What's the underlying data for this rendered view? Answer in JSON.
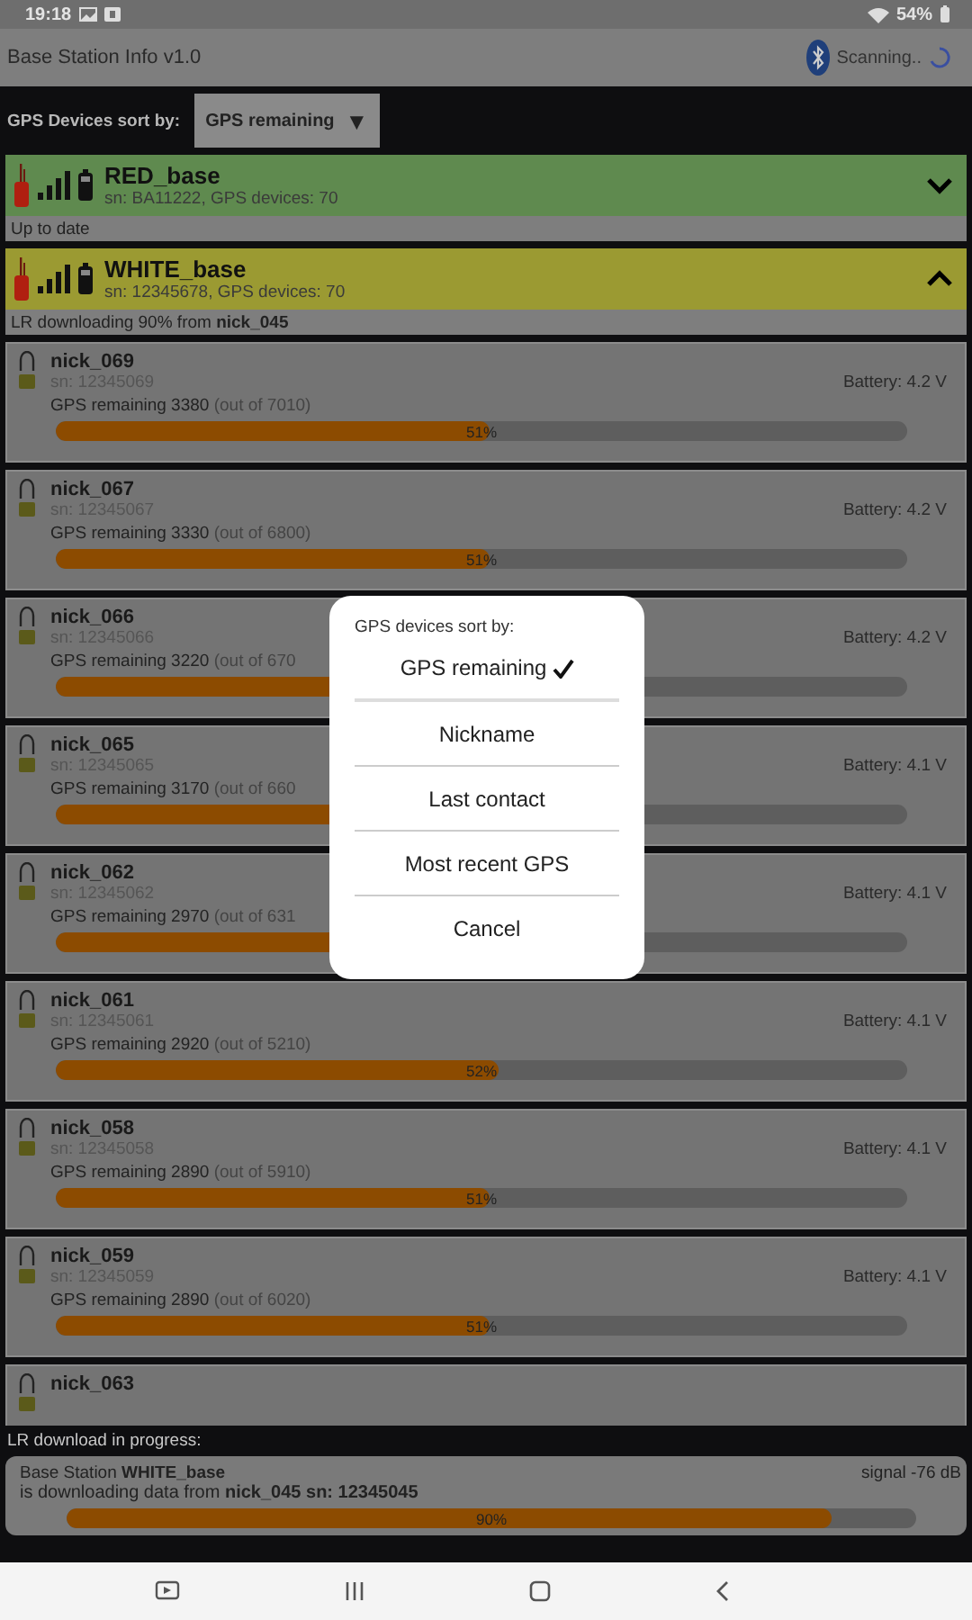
{
  "status_bar": {
    "time": "19:18",
    "battery": "54%"
  },
  "app_bar": {
    "title": "Base Station Info v1.0",
    "scan_status": "Scanning.."
  },
  "sort_bar": {
    "label": "GPS Devices sort by:",
    "value": "GPS remaining",
    "arrow": "▼"
  },
  "base_stations": [
    {
      "name": "RED_base",
      "details": "sn: BA11222, GPS devices: 70",
      "color": "#5f8a4f",
      "expanded": false,
      "status": "Up to date"
    },
    {
      "name": "WHITE_base",
      "details": "sn: 12345678, GPS devices: 70",
      "color": "#9b9a32",
      "expanded": true,
      "status": "LR downloading 90% from **nick_045**"
    }
  ],
  "devices": [
    {
      "name": "nick_069",
      "sn": "sn: 12345069",
      "battery": "Battery: 4.2 V",
      "remaining": "GPS remaining 3380",
      "total": "(out of 7010)",
      "level": 0.51,
      "percent": "51%"
    },
    {
      "name": "nick_067",
      "sn": "sn: 12345067",
      "battery": "Battery: 4.2 V",
      "remaining": "GPS remaining 3330",
      "total": "(out of 6800)",
      "level": 0.51,
      "percent": "51%"
    },
    {
      "name": "nick_066",
      "sn": "sn: 12345066",
      "battery": "Battery: 4.2 V",
      "remaining": "GPS remaining 3220",
      "total": "(out of 670",
      "level": 0.51
    },
    {
      "name": "nick_065",
      "sn": "sn: 12345065",
      "battery": "Battery: 4.1 V",
      "remaining": "GPS remaining 3170",
      "total": "(out of 660",
      "level": 0.51
    },
    {
      "name": "nick_062",
      "sn": "sn: 12345062",
      "battery": "Battery: 4.1 V",
      "remaining": "GPS remaining 2970",
      "total": "(out of 631",
      "level": 0.51
    },
    {
      "name": "nick_061",
      "sn": "sn: 12345061",
      "battery": "Battery: 4.1 V",
      "remaining": "GPS remaining 2920",
      "total": "(out of 5210)",
      "level": 0.52,
      "percent": "52%"
    },
    {
      "name": "nick_058",
      "sn": "sn: 12345058",
      "battery": "Battery: 4.1 V",
      "remaining": "GPS remaining 2890",
      "total": "(out of 5910)",
      "level": 0.51,
      "percent": "51%"
    },
    {
      "name": "nick_059",
      "sn": "sn: 12345059",
      "battery": "Battery: 4.1 V",
      "remaining": "GPS remaining 2890",
      "total": "(out of 6020)",
      "level": 0.51,
      "percent": "51%"
    },
    {
      "name": "nick_063"
    }
  ],
  "download_panel": {
    "heading": "LR download in progress:",
    "station": "Base Station **WHITE_base**",
    "signal": "signal -76 dB",
    "source": "is downloading data from **nick_045 sn: 12345045**",
    "level": 0.9,
    "percent": "90%"
  },
  "dialog": {
    "title": "GPS devices sort by:",
    "options": [
      {
        "label": "GPS remaining",
        "selected": true
      },
      {
        "label": "Nickname",
        "selected": false
      },
      {
        "label": "Last contact",
        "selected": false
      },
      {
        "label": "Most recent GPS",
        "selected": false
      }
    ],
    "cancel": "Cancel"
  }
}
